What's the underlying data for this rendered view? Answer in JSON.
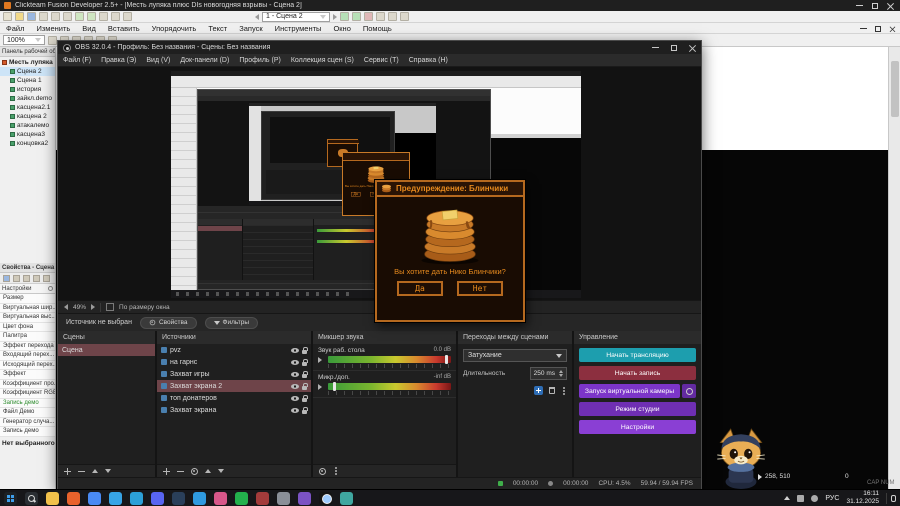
{
  "fusion": {
    "title": "Clickteam Fusion Developer 2.5+ - [Месть лупяка плюс DIs новогодняя взрывы - Сцена 2]",
    "menu": [
      "Файл",
      "Изменить",
      "Вид",
      "Вставить",
      "Упорядочить",
      "Текст",
      "Запуск",
      "Инструменты",
      "Окно",
      "Помощь"
    ],
    "scene_selector": "1 - Сцена 2",
    "zoom_value": "100%",
    "workspace_title": "Панель рабочей об...",
    "tree": [
      {
        "label": "Месть лупяка п...",
        "root": true
      },
      {
        "label": "Сцена 2",
        "selected": true
      },
      {
        "label": "Сцена 1"
      },
      {
        "label": "история"
      },
      {
        "label": "зайкл.demo"
      },
      {
        "label": "касцена2.1"
      },
      {
        "label": "касцена 2"
      },
      {
        "label": "атакалемо"
      },
      {
        "label": "касцена3"
      },
      {
        "label": "концовка2"
      }
    ],
    "properties_title": "Свойства - Сцена 2",
    "settings_tab": "Настройки",
    "properties": [
      {
        "label": "Размер"
      },
      {
        "label": "Виртуальная шир..."
      },
      {
        "label": "Виртуальная выс..."
      },
      {
        "label": "Цвет фона"
      },
      {
        "label": "Палитра"
      },
      {
        "label": "Эффект перехода"
      },
      {
        "label": "Входящий перех..."
      },
      {
        "label": "Исходящий перех..."
      },
      {
        "label": "Эффект"
      },
      {
        "label": "Коэффициент про..."
      },
      {
        "label": "Коэффициент RGB"
      },
      {
        "label": "Запись демо",
        "highlight": true
      },
      {
        "label": "Файл Демо"
      },
      {
        "label": "Генератор случа..."
      },
      {
        "label": "Запись демо"
      }
    ],
    "no_selection": "Нет выбранного эл...",
    "coords": "258, 510",
    "coords_extra": "0",
    "status_flags": "CAP NUM"
  },
  "obs": {
    "title": "OBS 32.0.4 - Профиль: Без названия - Сцены: Без названия",
    "menu": [
      "Файл (F)",
      "Правка (Э)",
      "Вид (V)",
      "Док-панели (D)",
      "Профиль (P)",
      "Коллекция сцен (S)",
      "Сервис (T)",
      "Справка (H)"
    ],
    "zoom": "49%",
    "fit_label": "По размеру окна",
    "no_source": "Источник не выбран",
    "properties_btn": "Свойства",
    "filters_btn": "Фильтры",
    "scenes": {
      "title": "Сцены",
      "items": [
        {
          "label": "Сцена",
          "selected": true
        }
      ]
    },
    "sources": {
      "title": "Источники",
      "items": [
        {
          "label": "pvz"
        },
        {
          "label": "на гарнс"
        },
        {
          "label": "Захват игры"
        },
        {
          "label": "Захват экрана 2",
          "selected": true
        },
        {
          "label": "топ донатеров"
        },
        {
          "label": "Захват экрана"
        }
      ]
    },
    "mixer": {
      "title": "Микшер звука",
      "channels": [
        {
          "name": "Звук раб. стола",
          "db": "0.0 dB",
          "fader": 95
        },
        {
          "name": "Микр./доп.",
          "db": "-inf dB",
          "fader": 4
        }
      ]
    },
    "transitions": {
      "title": "Переходы между сценами",
      "selected": "Затухание",
      "duration_label": "Длительность",
      "duration": "250 ms"
    },
    "controls": {
      "title": "Управление",
      "buttons": [
        {
          "label": "Начать трансляцию",
          "color": "#1d9eae"
        },
        {
          "label": "Начать запись",
          "color": "#8c2f3f"
        },
        {
          "label": "Запуск виртуальной камеры",
          "color": "#7c35c9",
          "gear": true
        },
        {
          "label": "Режим студии",
          "color": "#6f2fb3"
        },
        {
          "label": "Настройки",
          "color": "#8a3fd4"
        }
      ]
    },
    "status": {
      "rec": "00:00:00",
      "stream": "00:00:00",
      "cpu": "CPU: 4.5%",
      "fps": "59.94 / 59.94 FPS"
    }
  },
  "dialog": {
    "title": "Предупреждение: Блинчики",
    "message": "Вы хотите дать Нико Блинчики?",
    "yes": "Да",
    "no": "Нет"
  },
  "taskbar": {
    "icons": [
      {
        "name": "start",
        "color": "#1d2125",
        "shape": "win"
      },
      {
        "name": "search",
        "color": "#2a2e33",
        "shape": "search"
      },
      {
        "name": "explorer",
        "color": "#f2c14b"
      },
      {
        "name": "browser",
        "color": "#e8622c"
      },
      {
        "name": "chrome",
        "color": "#4a8af4"
      },
      {
        "name": "mail",
        "color": "#37a4e6"
      },
      {
        "name": "telegram",
        "color": "#2ca0d8"
      },
      {
        "name": "discord",
        "color": "#5865f2"
      },
      {
        "name": "steam",
        "color": "#2a3f5a"
      },
      {
        "name": "vscode",
        "color": "#2f9ae0"
      },
      {
        "name": "paint",
        "color": "#d8578a"
      },
      {
        "name": "spotify",
        "color": "#23b14d"
      },
      {
        "name": "game",
        "color": "#a33b3b"
      },
      {
        "name": "files",
        "color": "#8a8f98"
      },
      {
        "name": "photos",
        "color": "#7b53c4"
      },
      {
        "name": "obs",
        "color": "#141414",
        "shape": "ring",
        "active": true
      },
      {
        "name": "capture",
        "color": "#3fa7a0"
      }
    ],
    "tray_lang": "РУС",
    "time": "16:11",
    "date": "31.12.2025"
  }
}
